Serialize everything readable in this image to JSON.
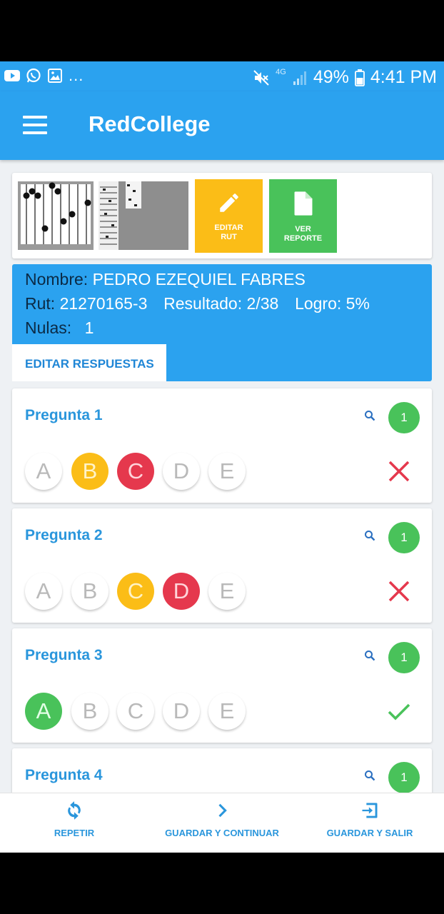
{
  "status_bar": {
    "battery": "49%",
    "time": "4:41 PM",
    "network": "4G",
    "overflow": "..."
  },
  "app": {
    "title": "RedCollege"
  },
  "actions": {
    "edit_rut": "EDITAR\nRUT",
    "view_report": "VER\nREPORTE"
  },
  "student": {
    "name_label": "Nombre:",
    "name": "PEDRO EZEQUIEL FABRES",
    "rut_label": "Rut:",
    "rut": "21270165-3",
    "result_label": "Resultado:",
    "result": "2/38",
    "achievement_label": "Logro:",
    "achievement": "5%",
    "nulls_label": "Nulas:",
    "nulls": "1",
    "edit_answers": "EDITAR RESPUESTAS"
  },
  "questions": [
    {
      "title": "Pregunta 1",
      "badge": "1",
      "options": [
        "A",
        "B",
        "C",
        "D",
        "E"
      ],
      "result": "wrong"
    },
    {
      "title": "Pregunta 2",
      "badge": "1",
      "options": [
        "A",
        "B",
        "C",
        "D",
        "E"
      ],
      "result": "wrong"
    },
    {
      "title": "Pregunta 3",
      "badge": "1",
      "options": [
        "A",
        "B",
        "C",
        "D",
        "E"
      ],
      "result": "correct"
    },
    {
      "title": "Pregunta 4",
      "badge": "1"
    }
  ],
  "bottom_bar": {
    "repeat": "REPETIR",
    "save_continue": "GUARDAR Y CONTINUAR",
    "save_exit": "GUARDAR Y SALIR"
  },
  "colors": {
    "primary": "#2ba2ef",
    "yellow": "#fbbd17",
    "red": "#e5384d",
    "green": "#49c25a"
  }
}
